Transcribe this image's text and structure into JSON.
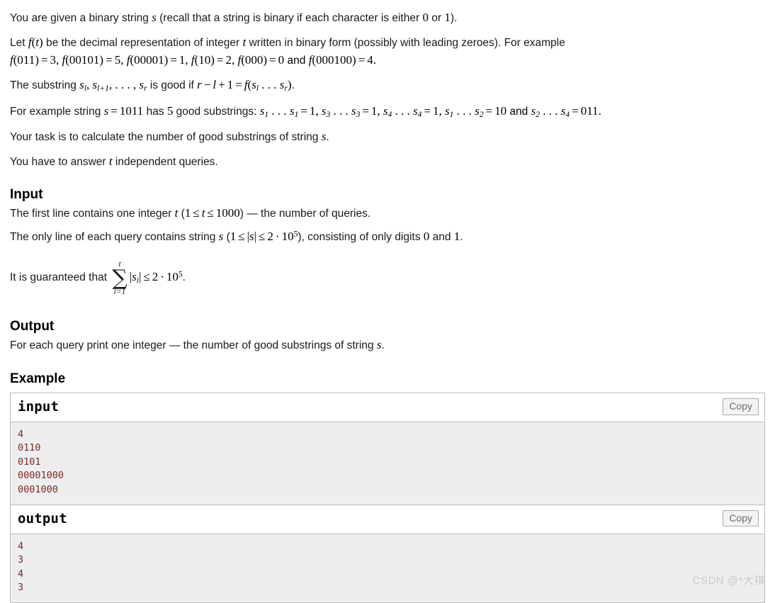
{
  "statement": {
    "p1": {
      "t1": "You are given a binary string ",
      "s": "s",
      "t2": " (recall that a string is binary if each character is either ",
      "zero": "0",
      "t3": " or ",
      "one": "1",
      "t4": ")."
    },
    "p2": {
      "t1": "Let ",
      "f": "f",
      "paren_open": "(",
      "t_var": "t",
      "paren_close": ")",
      "t2": " be the decimal representation of integer ",
      "t_var2": "t",
      "t3": " written in binary form (possibly with leading zeroes). For example",
      "examples": "f(011) = 3, f(00101) = 5, f(00001) = 1, f(10) = 2, f(000) = 0 and f(000100) = 4.",
      "ex": [
        {
          "arg": "011",
          "val": "3",
          "sep": ", "
        },
        {
          "arg": "00101",
          "val": "5",
          "sep": ", "
        },
        {
          "arg": "00001",
          "val": "1",
          "sep": ", "
        },
        {
          "arg": "10",
          "val": "2",
          "sep": ", "
        },
        {
          "arg": "000",
          "val": "0",
          "sep": " and "
        },
        {
          "arg": "000100",
          "val": "4",
          "sep": "."
        }
      ]
    },
    "p3": {
      "t1": "The substring ",
      "s_l": "s",
      "sub_l": "l",
      "comma1": ", ",
      "s_l1": "s",
      "sub_l1": "l+1",
      "comma2": ", ",
      "dots": ". . . ",
      "comma3": ", ",
      "s_r": "s",
      "sub_r": "r",
      "t2": " is good if ",
      "r": "r",
      "minus": "−",
      "l": "l",
      "plus": "+",
      "one": "1",
      "eq": "=",
      "f": "f",
      "inner": "(s_l . . . s_r)",
      "t3": "."
    },
    "p4": {
      "t1": "For example string ",
      "s": "s",
      "eq": "=",
      "val": "1011",
      "t2": " has ",
      "count": "5",
      "t3": " good substrings: ",
      "items": [
        {
          "left_sub": "1",
          "right_sub": "1",
          "value": "1",
          "sep": ", "
        },
        {
          "left_sub": "3",
          "right_sub": "3",
          "value": "1",
          "sep": ", "
        },
        {
          "left_sub": "4",
          "right_sub": "4",
          "value": "1",
          "sep": ", "
        },
        {
          "left_sub": "1",
          "right_sub": "2",
          "value": "10",
          "sep": " and "
        },
        {
          "left_sub": "2",
          "right_sub": "4",
          "value": "011",
          "sep": "."
        }
      ]
    },
    "p5": {
      "t1": "Your task is to calculate the number of good substrings of string ",
      "s": "s",
      "t2": "."
    },
    "p6": {
      "t1": "You have to answer ",
      "t_var": "t",
      "t2": " independent queries."
    }
  },
  "input_section": {
    "heading": "Input",
    "line1": {
      "t1": "The first line contains one integer ",
      "t_var": "t",
      "t2": " (",
      "one": "1",
      "le1": "≤",
      "t_var2": "t",
      "le2": "≤",
      "bound": "1000",
      "t3": ") — the number of queries."
    },
    "line2": {
      "t1": "The only line of each query contains string ",
      "s": "s",
      "t2": " (",
      "one": "1",
      "le1": "≤",
      "abs_s": "|s|",
      "le2": "≤",
      "two": "2",
      "cdot": "·",
      "ten": "10",
      "exp": "5",
      "t3": "), consisting of only digits ",
      "digit0": "0",
      "t4": " and ",
      "digit1": "1",
      "t5": "."
    },
    "line3": {
      "t1": "It is guaranteed that ",
      "sum_upper": "t",
      "sum_sigma": "∑",
      "sum_lower": "i=1",
      "abs_si": "|s",
      "abs_si_sub": "i",
      "abs_si_end": "|",
      "le": "≤",
      "two": "2",
      "cdot": "·",
      "ten": "10",
      "exp": "5",
      "t2": "."
    }
  },
  "output_section": {
    "heading": "Output",
    "line1": {
      "t1": "For each query print one integer — the number of good substrings of string ",
      "s": "s",
      "t2": "."
    }
  },
  "example_section": {
    "heading": "Example",
    "samples": [
      {
        "title": "input",
        "copy_label": "Copy",
        "content": "4\n0110\n0101\n00001000\n0001000"
      },
      {
        "title": "output",
        "copy_label": "Copy",
        "content": "4\n3\n4\n3"
      }
    ]
  },
  "watermark": {
    "text": "CSDN @*大祺"
  },
  "colors": {
    "code_text": "#7a2a2a",
    "sample_bg": "#eeeeee",
    "border": "#bbbbbb",
    "watermark": "#c9c9c9"
  }
}
